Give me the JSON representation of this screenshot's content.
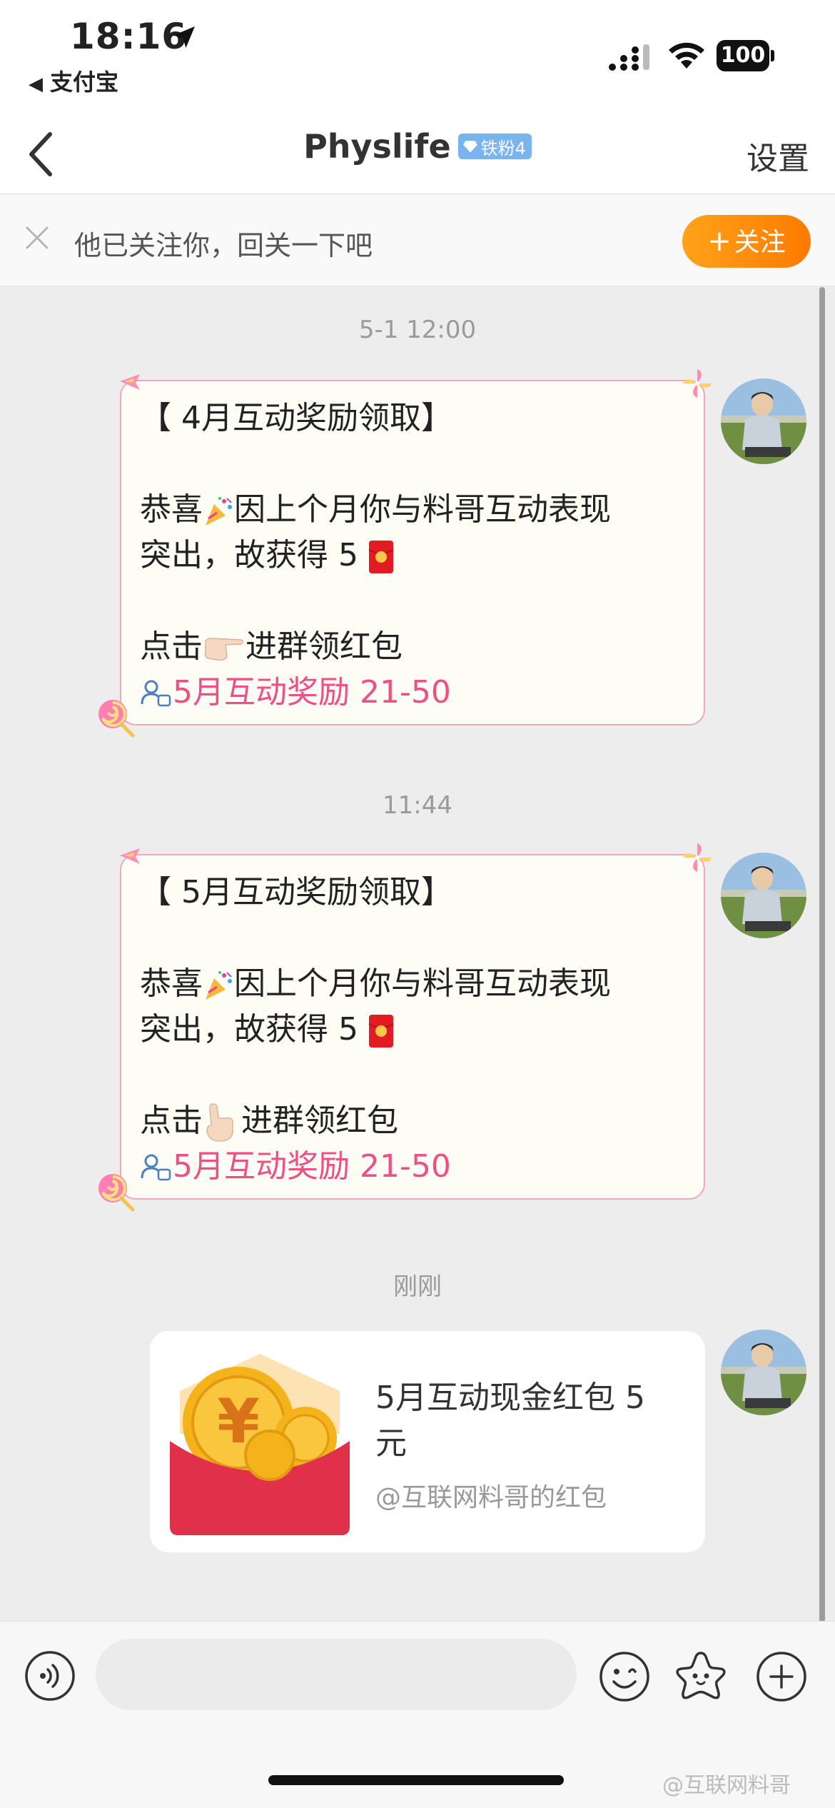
{
  "status_bar": {
    "time": "18:16",
    "back_app": "支付宝",
    "battery": "100"
  },
  "header": {
    "title": "Physlife",
    "badge": "铁粉4",
    "settings": "设置"
  },
  "follow_bar": {
    "text": "他已关注你，回关一下吧",
    "button": "关注"
  },
  "messages": [
    {
      "timestamp": "5-1 12:00",
      "title": "【 4月互动奖励领取】",
      "line1": "恭喜",
      "line1b": "因上个月你与料哥互动表现",
      "line2": "突出，故获得 5",
      "line3a": "点击",
      "line3b": "进群领红包",
      "link": "5月互动奖励 21-50"
    },
    {
      "timestamp": "11:44",
      "title": "【 5月互动奖励领取】",
      "line1": "恭喜",
      "line1b": "因上个月你与料哥互动表现",
      "line2": "突出，故获得 5",
      "line3a": "点击",
      "line3b": "进群领红包",
      "link": "5月互动奖励 21-50"
    }
  ],
  "packet": {
    "timestamp": "刚刚",
    "title": "5月互动现金红包 5 元",
    "subtitle": "@互联网料哥的红包"
  },
  "watermark": "@互联网料哥",
  "icons": {
    "location": "location-arrow-icon",
    "signal": "cellular-signal-icon",
    "wifi": "wifi-icon",
    "back": "chevron-left-icon",
    "close": "close-icon",
    "voice": "voice-icon",
    "emoji": "smiley-icon",
    "sticker": "star-sticker-icon",
    "plus": "plus-icon"
  },
  "colors": {
    "accent_orange": "#ff8a00",
    "link_pink": "#ee4f86",
    "bubble_border": "#f2a6bd",
    "badge_blue": "#79b3f0",
    "packet_red": "#e0304a"
  }
}
